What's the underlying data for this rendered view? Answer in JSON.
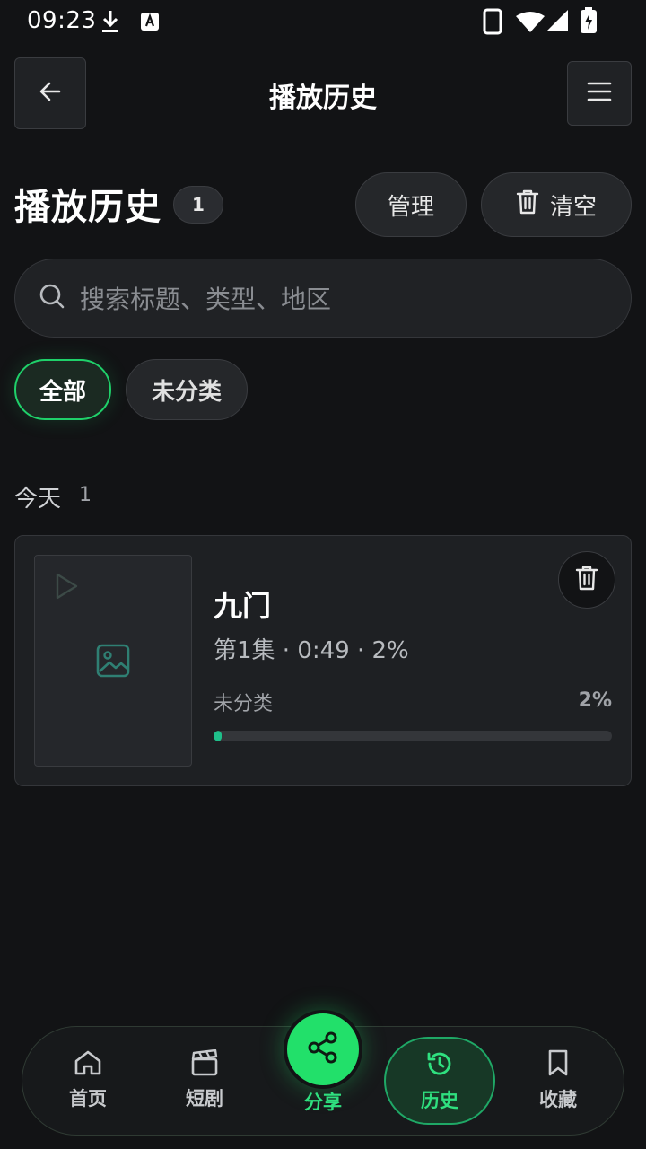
{
  "status_bar": {
    "time": "09:23"
  },
  "header": {
    "title": "播放历史"
  },
  "section": {
    "title": "播放历史",
    "count": "1",
    "manage_label": "管理",
    "clear_label": "清空"
  },
  "search": {
    "placeholder": "搜索标题、类型、地区"
  },
  "filters": [
    {
      "label": "全部",
      "active": true
    },
    {
      "label": "未分类",
      "active": false
    }
  ],
  "groups": [
    {
      "label": "今天",
      "count": "1",
      "items": [
        {
          "title": "九门",
          "meta": "第1集 · 0:49 · 2%",
          "category": "未分类",
          "progress_label": "2%",
          "progress": 0.02
        }
      ]
    }
  ],
  "bottom_nav": {
    "home": "首页",
    "shorts": "短剧",
    "share": "分享",
    "history": "历史",
    "favorites": "收藏"
  },
  "colors": {
    "background": "#121315",
    "accent": "#22e06a",
    "progress": "#1fbf8a"
  }
}
